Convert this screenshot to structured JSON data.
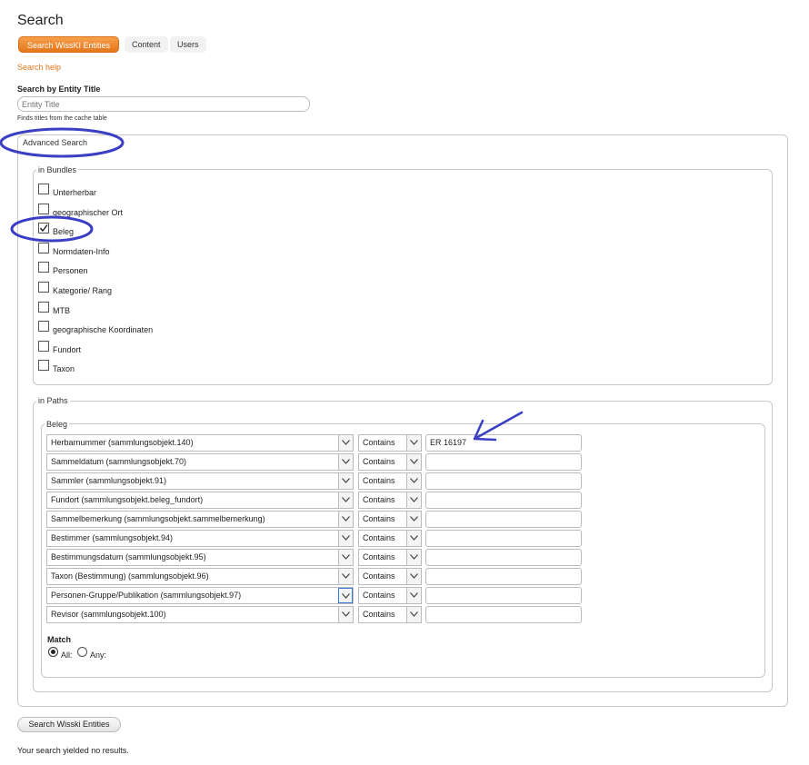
{
  "page": {
    "title": "Search"
  },
  "tabs": [
    {
      "label": "Search WissKI Entities"
    },
    {
      "label": "Content"
    },
    {
      "label": "Users"
    }
  ],
  "search_help": "Search help",
  "entity_title": {
    "label": "Search by Entity Title",
    "placeholder": "Entity Title",
    "description": "Finds titles from the cache table"
  },
  "advanced": {
    "label": "Advanced Search",
    "bundles_legend": "in Bundles",
    "bundles": [
      {
        "label": "Unterherbar",
        "checked": false
      },
      {
        "label": "geographischer Ort",
        "checked": false
      },
      {
        "label": "Beleg",
        "checked": true
      },
      {
        "label": "Normdaten-Info",
        "checked": false
      },
      {
        "label": "Personen",
        "checked": false
      },
      {
        "label": "Kategorie/ Rang",
        "checked": false
      },
      {
        "label": "MTB",
        "checked": false
      },
      {
        "label": "geographische Koordinaten",
        "checked": false
      },
      {
        "label": "Fundort",
        "checked": false
      },
      {
        "label": "Taxon",
        "checked": false
      }
    ],
    "paths_legend": "in Paths",
    "beleg_legend": "Beleg",
    "paths": [
      {
        "path": "Herbarnummer (sammlungsobjekt.140)",
        "operator": "Contains",
        "value": "ER 16197"
      },
      {
        "path": "Sammeldatum (sammlungsobjekt.70)",
        "operator": "Contains",
        "value": ""
      },
      {
        "path": "Sammler (sammlungsobjekt.91)",
        "operator": "Contains",
        "value": ""
      },
      {
        "path": "Fundort (sammlungsobjekt.beleg_fundort)",
        "operator": "Contains",
        "value": ""
      },
      {
        "path": "Sammelbemerkung (sammlungsobjekt.sammelbemerkung)",
        "operator": "Contains",
        "value": ""
      },
      {
        "path": "Bestimmer (sammlungsobjekt.94)",
        "operator": "Contains",
        "value": ""
      },
      {
        "path": "Bestimmungsdatum (sammlungsobjekt.95)",
        "operator": "Contains",
        "value": ""
      },
      {
        "path": "Taxon (Bestimmung) (sammlungsobjekt.96)",
        "operator": "Contains",
        "value": ""
      },
      {
        "path": "Personen-Gruppe/Publikation (sammlungsobjekt.97)",
        "operator": "Contains",
        "value": ""
      },
      {
        "path": "Revisor (sammlungsobjekt.100)",
        "operator": "Contains",
        "value": ""
      }
    ],
    "match_label": "Match",
    "match_all": "All:",
    "match_any": "Any:",
    "match_selected": "All"
  },
  "submit_label": "Search Wisski Entities",
  "result_text": "Your search yielded no results.",
  "colors": {
    "accent": "#e4761b",
    "annotation": "#3b3fc4"
  }
}
